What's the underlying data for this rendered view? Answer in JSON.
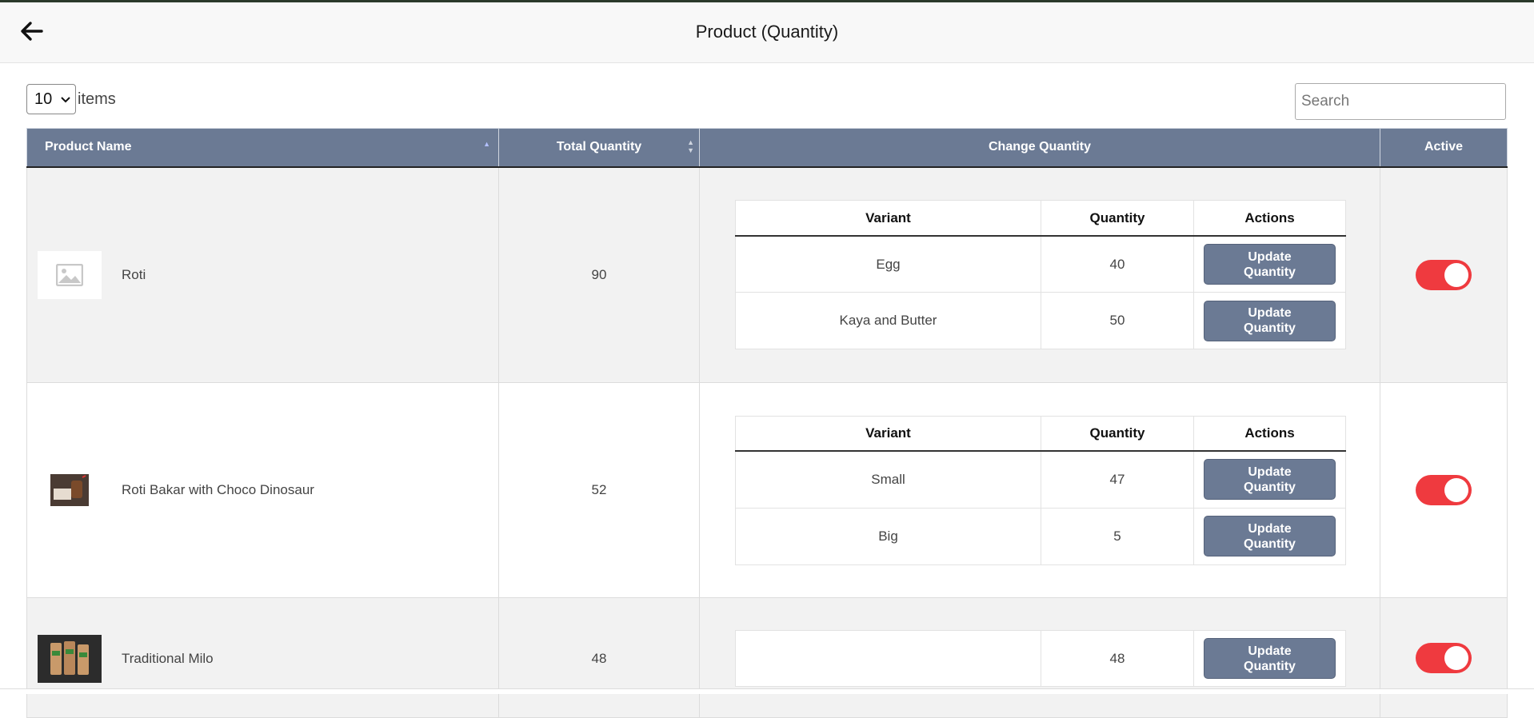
{
  "header": {
    "title": "Product (Quantity)"
  },
  "controls": {
    "page_size": "10",
    "items_label": "items",
    "search_placeholder": "Search"
  },
  "columns": {
    "product_name": "Product Name",
    "total_quantity": "Total Quantity",
    "change_quantity": "Change Quantity",
    "active": "Active"
  },
  "variant_columns": {
    "variant": "Variant",
    "quantity": "Quantity",
    "actions": "Actions"
  },
  "update_button": {
    "line1": "Update",
    "line2": "Quantity"
  },
  "rows": [
    {
      "name": "Roti",
      "total": "90",
      "active": true,
      "variants": [
        {
          "variant": "Egg",
          "quantity": "40"
        },
        {
          "variant": "Kaya and Butter",
          "quantity": "50"
        }
      ]
    },
    {
      "name": "Roti Bakar with Choco Dinosaur",
      "total": "52",
      "active": true,
      "variants": [
        {
          "variant": "Small",
          "quantity": "47"
        },
        {
          "variant": "Big",
          "quantity": "5"
        }
      ]
    },
    {
      "name": "Traditional Milo",
      "total": "48",
      "active": true,
      "single_quantity": "48"
    }
  ],
  "colors": {
    "header_bg": "#6b7a94",
    "toggle_on": "#ef3a3f",
    "button_bg": "#6b7a94"
  }
}
